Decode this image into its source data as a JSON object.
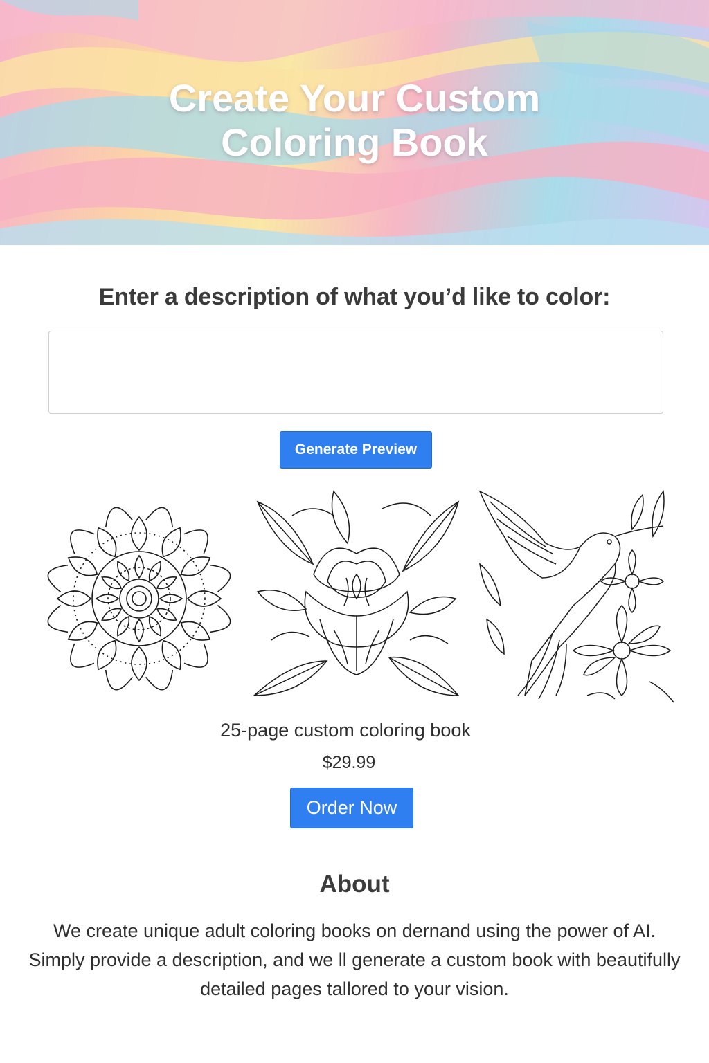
{
  "hero": {
    "title_line1": "Create Your Custom",
    "title_line2": "Coloring Book"
  },
  "prompt": {
    "label": "Enter a description of what you’d like to color:",
    "input_value": "",
    "input_placeholder": ""
  },
  "generate_button": {
    "label": "Generate Preview"
  },
  "previews": [
    {
      "subject": "mandala"
    },
    {
      "subject": "flower-with-leaves"
    },
    {
      "subject": "hummingbird-with-flowers"
    }
  ],
  "product": {
    "name": "25-page custom coloring book",
    "price": "$29.99",
    "order_label": "Order Now"
  },
  "about": {
    "title": "About",
    "body": "We create unique adult coloring books on dernand using the power of AI. Simply provide a description, and we ll generate a custom book with beautifully detailed pages tallored to your vision."
  },
  "colors": {
    "accent": "#2f7ff0",
    "text": "#3a3a3a",
    "hero_pink": "#f7b3c8",
    "hero_yellow": "#f9e8a6",
    "hero_blue": "#a9dcea",
    "hero_lavender": "#d6c6ef"
  }
}
